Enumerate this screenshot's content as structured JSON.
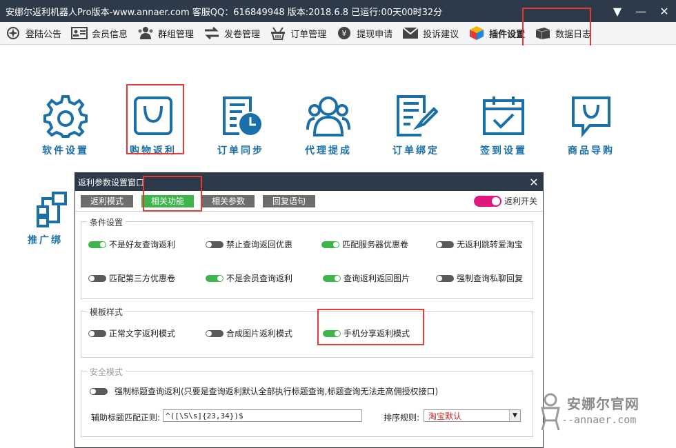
{
  "titlebar": {
    "title": "安娜尔返利机器人Pro版本-www.annaer.com 客服QQ：616849948 版本:2018.6.8      已运行:00天00时32分"
  },
  "nav": {
    "items": [
      {
        "label": "登陆公告",
        "icon": "compass-icon"
      },
      {
        "label": "会员信息",
        "icon": "id-card-icon"
      },
      {
        "label": "群组管理",
        "icon": "group-icon"
      },
      {
        "label": "发卷管理",
        "icon": "exchange-arrows-icon"
      },
      {
        "label": "订单管理",
        "icon": "basket-icon"
      },
      {
        "label": "提现申请",
        "icon": "yen-coin-icon"
      },
      {
        "label": "投诉建议",
        "icon": "envelope-icon"
      },
      {
        "label": "插件设置",
        "icon": "cube-icon"
      },
      {
        "label": "数据日志",
        "icon": "box-icon"
      }
    ]
  },
  "tiles": [
    {
      "label": "软件设置",
      "icon": "gear-icon"
    },
    {
      "label": "购物返利",
      "icon": "shopping-bag-icon"
    },
    {
      "label": "订单同步",
      "icon": "document-clock-icon"
    },
    {
      "label": "代理提成",
      "icon": "users-icon"
    },
    {
      "label": "订单绑定",
      "icon": "checklist-document-icon"
    },
    {
      "label": "签到设置",
      "icon": "calendar-check-icon"
    },
    {
      "label": "商品导购",
      "icon": "chat-bag-icon"
    },
    {
      "label": "推广绑",
      "icon": "org-chart-icon"
    }
  ],
  "dialog": {
    "title": "返利参数设置窗口",
    "tabs": [
      "返利模式",
      "相关功能",
      "相关参数",
      "回复语句"
    ],
    "active_tab": "相关功能",
    "master_switch": {
      "label": "返利开关",
      "on": true
    },
    "groups": {
      "conditions": {
        "label": "条件设置",
        "options": [
          {
            "label": "不是好友查询返利",
            "on": true
          },
          {
            "label": "禁止查询返回优惠",
            "on": false
          },
          {
            "label": "匹配服务器优惠卷",
            "on": true
          },
          {
            "label": "无返利跳转爱淘宝",
            "on": false
          },
          {
            "label": "匹配第三方优惠卷",
            "on": false
          },
          {
            "label": "不是会员查询返利",
            "on": true
          },
          {
            "label": "查询返利返回图片",
            "on": true
          },
          {
            "label": "强制查询私聊回复",
            "on": false
          }
        ]
      },
      "template": {
        "label": "模板样式",
        "options": [
          {
            "label": "正常文字返利模式",
            "on": false
          },
          {
            "label": "合成图片返利模式",
            "on": false
          },
          {
            "label": "手机分享返利模式",
            "on": true
          }
        ]
      },
      "security": {
        "label": "安全模式",
        "force_option": {
          "label": "强制标题查询返利(只要是查询返利默认全部执行标题查询,标题查询无法走高佣授权接口)",
          "on": false
        },
        "regex_label": "辅助标题匹配正则:",
        "regex_value": "^([\\S\\s]{23,34})$",
        "sort_label": "排序规则:",
        "sort_value": "淘宝默认"
      }
    }
  },
  "watermark": {
    "name": "安娜尔官网",
    "url": "--annaer.com"
  },
  "colors": {
    "titlebar": "#2d3a4a",
    "accent_blue": "#1a6fa8",
    "toggle_on": "#3cb54a",
    "toggle_off": "#5a5a5a",
    "master_toggle": "#e0177f",
    "highlight_red": "#e53935"
  }
}
